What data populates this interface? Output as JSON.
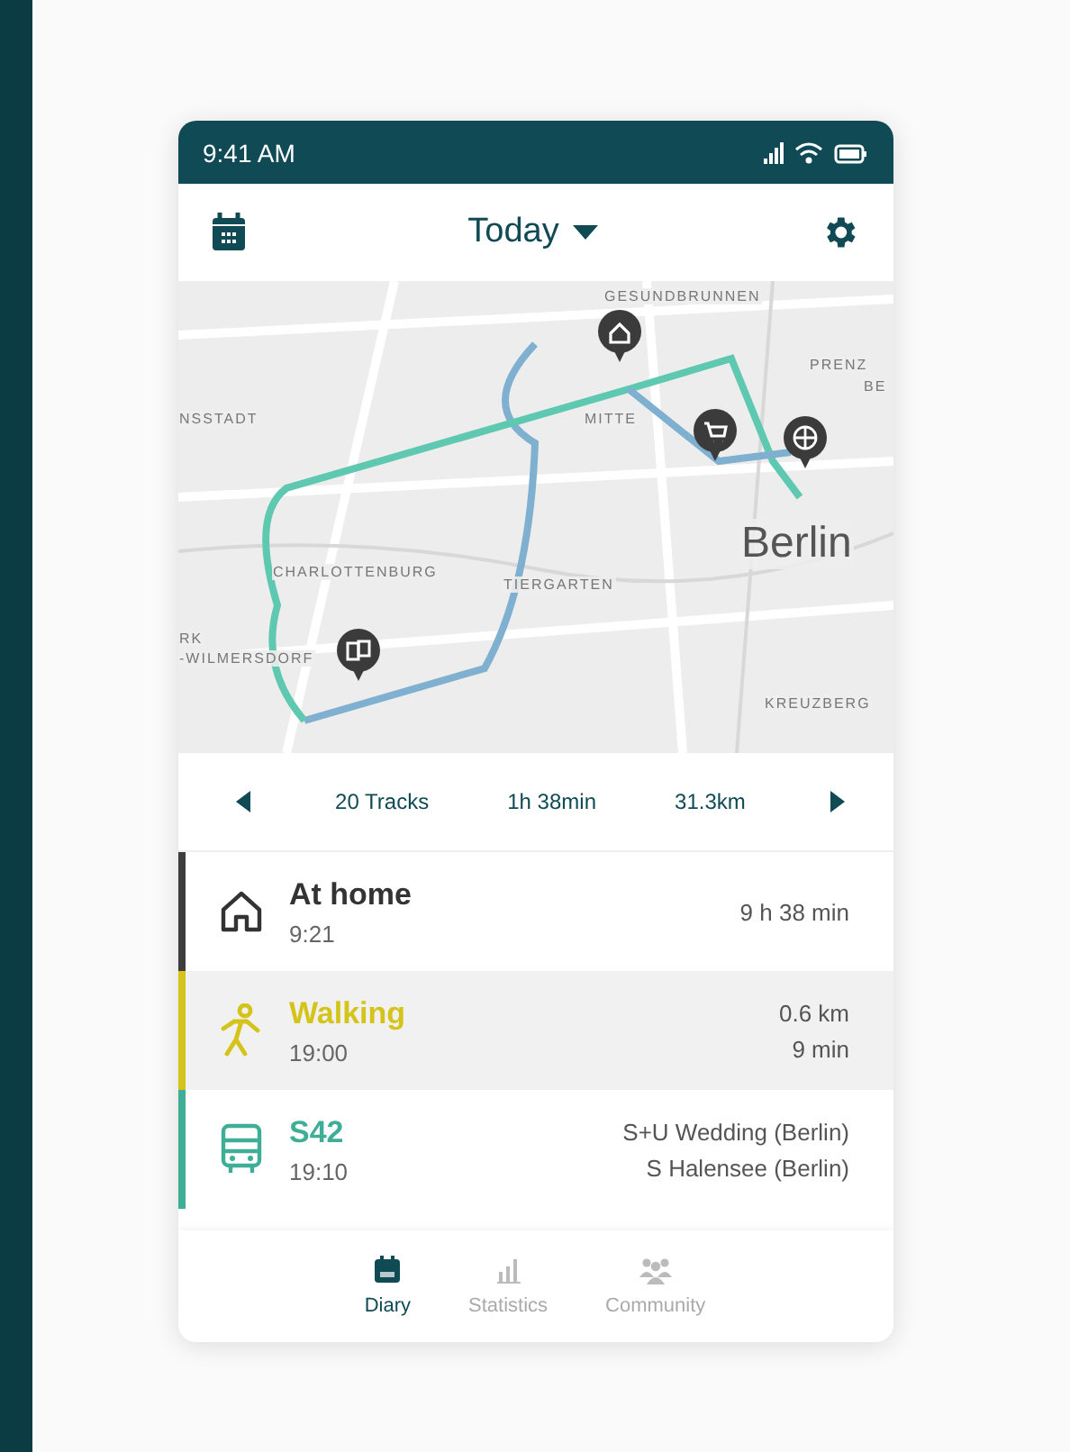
{
  "status_bar": {
    "time": "9:41 AM"
  },
  "header": {
    "title": "Today"
  },
  "map": {
    "labels": [
      "GESUNDBRUNNEN",
      "NSSTADT",
      "MITTE",
      "PRENZ",
      "BE",
      "Berlin",
      "CHARLOTTENBURG",
      "TIERGARTEN",
      "RK",
      "-WILMERSDORF",
      "KREUZBERG"
    ],
    "pins": [
      {
        "kind": "home"
      },
      {
        "kind": "shop"
      },
      {
        "kind": "sport"
      },
      {
        "kind": "drinks"
      }
    ]
  },
  "summary": {
    "tracks": "20 Tracks",
    "duration": "1h 38min",
    "distance": "31.3km"
  },
  "entries": [
    {
      "kind": "home",
      "color": "#3d3d3d",
      "selected": false,
      "title": "At home",
      "time": "9:21",
      "details": [
        "9 h 38 min"
      ]
    },
    {
      "kind": "walk",
      "color": "#d4c41a",
      "selected": true,
      "title": "Walking",
      "time": "19:00",
      "details": [
        "0.6 km",
        "9 min"
      ]
    },
    {
      "kind": "transit",
      "color": "#3fae97",
      "selected": false,
      "title": "S42",
      "time": "19:10",
      "details": [
        "S+U Wedding (Berlin)",
        "S Halensee (Berlin)"
      ]
    }
  ],
  "nav": [
    {
      "kind": "diary",
      "label": "Diary",
      "selected": true
    },
    {
      "kind": "stats",
      "label": "Statistics",
      "selected": false
    },
    {
      "kind": "community",
      "label": "Community",
      "selected": false
    }
  ]
}
